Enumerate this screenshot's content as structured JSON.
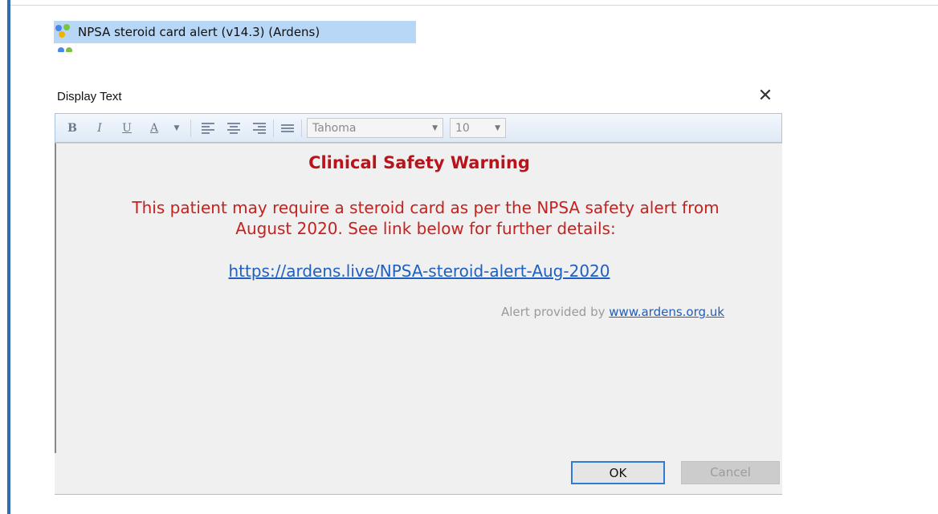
{
  "tree": {
    "item_label": "NPSA steroid card alert (v14.3) (Ardens)",
    "icon": "protocol-icon"
  },
  "dialog": {
    "title": "Display Text",
    "close_icon": "close-icon"
  },
  "toolbar": {
    "bold": "B",
    "italic": "I",
    "underline": "U",
    "font_color": "A",
    "font_family": "Tahoma",
    "font_size": "10"
  },
  "content": {
    "heading": "Clinical Safety Warning",
    "body_line1": "This patient may require a steroid card as per the NPSA safety alert from",
    "body_line2": "August 2020. See link below for further details:",
    "link": "https://ardens.live/NPSA-steroid-alert-Aug-2020",
    "provided_prefix": "Alert provided by",
    "provided_link": "www.ardens.org.uk"
  },
  "buttons": {
    "ok": "OK",
    "cancel": "Cancel"
  },
  "colors": {
    "warning_red": "#b8141c",
    "link_blue": "#1f5fbf",
    "selection": "#b8d6f5",
    "accent_bar": "#2e6db4"
  }
}
